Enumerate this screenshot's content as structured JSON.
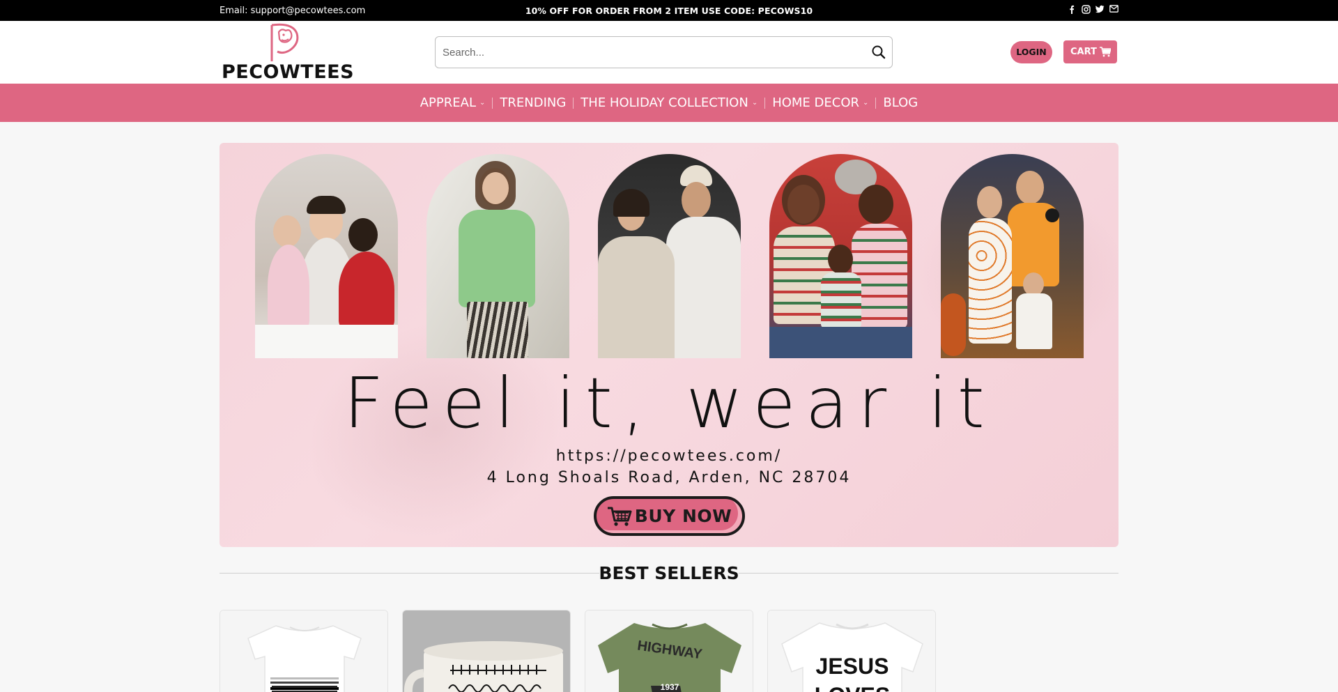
{
  "topbar": {
    "email": "Email: support@pecowtees.com",
    "promo": "10% OFF FOR ORDER FROM 2 ITEM USE CODE: PECOWS10",
    "social": [
      "facebook-icon",
      "instagram-icon",
      "twitter-icon",
      "mail-icon"
    ]
  },
  "header": {
    "brand": "PECOWTEES",
    "search": {
      "placeholder": "Search..."
    },
    "login_label": "LOGIN",
    "cart_label": "CART"
  },
  "nav": {
    "items": [
      {
        "label": "APPREAL",
        "has_dropdown": true
      },
      {
        "label": "TRENDING",
        "has_dropdown": false
      },
      {
        "label": "THE HOLIDAY COLLECTION",
        "has_dropdown": true
      },
      {
        "label": "HOME DECOR",
        "has_dropdown": true
      },
      {
        "label": "BLOG",
        "has_dropdown": false
      }
    ]
  },
  "hero": {
    "tagline": "Feel it, wear it",
    "url": "https://pecowtees.com/",
    "address": "4 Long Shoals Road, Arden, NC 28704",
    "button_label": "BUY NOW"
  },
  "best_sellers": {
    "title": "BEST SELLERS",
    "products": [
      {
        "image": "white-tshirt-pattern"
      },
      {
        "image": "ceramic-mug"
      },
      {
        "image": "olive-tshirt-highway-1937",
        "print_top": "HIGHWAY",
        "print_year": "1937"
      },
      {
        "image": "white-tshirt-jesus-loves",
        "print_top": "JESUS",
        "print_bottom": "LOVES"
      }
    ]
  },
  "colors": {
    "accent": "#de6682",
    "topbar_bg": "#000000",
    "hero_bg": "#f7d6dd"
  }
}
